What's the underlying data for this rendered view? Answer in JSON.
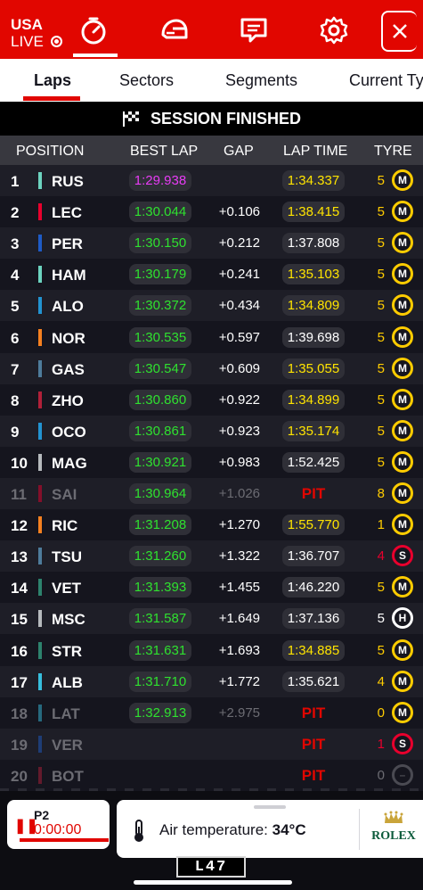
{
  "header": {
    "country": "USA",
    "live_label": "LIVE",
    "icons": [
      "timer-icon",
      "helmet-icon",
      "chat-icon",
      "gear-icon",
      "close-icon"
    ]
  },
  "tabs": [
    {
      "label": "Laps",
      "active": true
    },
    {
      "label": "Sectors",
      "active": false
    },
    {
      "label": "Segments",
      "active": false
    },
    {
      "label": "Current Ty",
      "active": false
    }
  ],
  "session_banner": "SESSION FINISHED",
  "columns": {
    "position": "POSITION",
    "best_lap": "BEST LAP",
    "gap": "GAP",
    "lap_time": "LAP TIME",
    "tyre": "TYRE"
  },
  "rows": [
    {
      "pos": "1",
      "code": "RUS",
      "team_color": "#6cd3bf",
      "best": "1:29.938",
      "best_color": "#e83cf5",
      "gap": "",
      "lap": "1:34.337",
      "lap_style": "yellow",
      "tyre_laps": "5",
      "tyre_laps_color": "#ffcc00",
      "tyre": "M",
      "tyre_type": "medium"
    },
    {
      "pos": "2",
      "code": "LEC",
      "team_color": "#e8002d",
      "best": "1:30.044",
      "best_color": "#2fe12f",
      "gap": "+0.106",
      "lap": "1:38.415",
      "lap_style": "yellow",
      "tyre_laps": "5",
      "tyre_laps_color": "#ffcc00",
      "tyre": "M",
      "tyre_type": "medium"
    },
    {
      "pos": "3",
      "code": "PER",
      "team_color": "#1e5bc6",
      "best": "1:30.150",
      "best_color": "#2fe12f",
      "gap": "+0.212",
      "lap": "1:37.808",
      "lap_style": "white",
      "tyre_laps": "5",
      "tyre_laps_color": "#ffcc00",
      "tyre": "M",
      "tyre_type": "medium"
    },
    {
      "pos": "4",
      "code": "HAM",
      "team_color": "#6cd3bf",
      "best": "1:30.179",
      "best_color": "#2fe12f",
      "gap": "+0.241",
      "lap": "1:35.103",
      "lap_style": "yellow",
      "tyre_laps": "5",
      "tyre_laps_color": "#ffcc00",
      "tyre": "M",
      "tyre_type": "medium"
    },
    {
      "pos": "5",
      "code": "ALO",
      "team_color": "#2293d1",
      "best": "1:30.372",
      "best_color": "#2fe12f",
      "gap": "+0.434",
      "lap": "1:34.809",
      "lap_style": "yellow",
      "tyre_laps": "5",
      "tyre_laps_color": "#ffcc00",
      "tyre": "M",
      "tyre_type": "medium"
    },
    {
      "pos": "6",
      "code": "NOR",
      "team_color": "#f58020",
      "best": "1:30.535",
      "best_color": "#2fe12f",
      "gap": "+0.597",
      "lap": "1:39.698",
      "lap_style": "white",
      "tyre_laps": "5",
      "tyre_laps_color": "#ffcc00",
      "tyre": "M",
      "tyre_type": "medium"
    },
    {
      "pos": "7",
      "code": "GAS",
      "team_color": "#4e7c9b",
      "best": "1:30.547",
      "best_color": "#2fe12f",
      "gap": "+0.609",
      "lap": "1:35.055",
      "lap_style": "yellow",
      "tyre_laps": "5",
      "tyre_laps_color": "#ffcc00",
      "tyre": "M",
      "tyre_type": "medium"
    },
    {
      "pos": "8",
      "code": "ZHO",
      "team_color": "#b12039",
      "best": "1:30.860",
      "best_color": "#2fe12f",
      "gap": "+0.922",
      "lap": "1:34.899",
      "lap_style": "yellow",
      "tyre_laps": "5",
      "tyre_laps_color": "#ffcc00",
      "tyre": "M",
      "tyre_type": "medium"
    },
    {
      "pos": "9",
      "code": "OCO",
      "team_color": "#2293d1",
      "best": "1:30.861",
      "best_color": "#2fe12f",
      "gap": "+0.923",
      "lap": "1:35.174",
      "lap_style": "yellow",
      "tyre_laps": "5",
      "tyre_laps_color": "#ffcc00",
      "tyre": "M",
      "tyre_type": "medium"
    },
    {
      "pos": "10",
      "code": "MAG",
      "team_color": "#b6babd",
      "best": "1:30.921",
      "best_color": "#2fe12f",
      "gap": "+0.983",
      "lap": "1:52.425",
      "lap_style": "white",
      "tyre_laps": "5",
      "tyre_laps_color": "#ffcc00",
      "tyre": "M",
      "tyre_type": "medium"
    },
    {
      "pos": "11",
      "code": "SAI",
      "team_color": "#e8002d",
      "best": "1:30.964",
      "best_color": "#2fe12f",
      "gap": "+1.026",
      "lap": "PIT",
      "lap_style": "pit",
      "tyre_laps": "8",
      "tyre_laps_color": "#ffcc00",
      "tyre": "M",
      "tyre_type": "medium",
      "dim": true
    },
    {
      "pos": "12",
      "code": "RIC",
      "team_color": "#f58020",
      "best": "1:31.208",
      "best_color": "#2fe12f",
      "gap": "+1.270",
      "lap": "1:55.770",
      "lap_style": "yellow",
      "tyre_laps": "1",
      "tyre_laps_color": "#ffcc00",
      "tyre": "M",
      "tyre_type": "medium"
    },
    {
      "pos": "13",
      "code": "TSU",
      "team_color": "#4e7c9b",
      "best": "1:31.260",
      "best_color": "#2fe12f",
      "gap": "+1.322",
      "lap": "1:36.707",
      "lap_style": "white",
      "tyre_laps": "4",
      "tyre_laps_color": "#e8002d",
      "tyre": "S",
      "tyre_type": "soft"
    },
    {
      "pos": "14",
      "code": "VET",
      "team_color": "#2d826d",
      "best": "1:31.393",
      "best_color": "#2fe12f",
      "gap": "+1.455",
      "lap": "1:46.220",
      "lap_style": "white",
      "tyre_laps": "5",
      "tyre_laps_color": "#ffcc00",
      "tyre": "M",
      "tyre_type": "medium"
    },
    {
      "pos": "15",
      "code": "MSC",
      "team_color": "#b6babd",
      "best": "1:31.587",
      "best_color": "#2fe12f",
      "gap": "+1.649",
      "lap": "1:37.136",
      "lap_style": "white",
      "tyre_laps": "5",
      "tyre_laps_color": "#ffffff",
      "tyre": "H",
      "tyre_type": "hard"
    },
    {
      "pos": "16",
      "code": "STR",
      "team_color": "#2d826d",
      "best": "1:31.631",
      "best_color": "#2fe12f",
      "gap": "+1.693",
      "lap": "1:34.885",
      "lap_style": "yellow",
      "tyre_laps": "5",
      "tyre_laps_color": "#ffcc00",
      "tyre": "M",
      "tyre_type": "medium"
    },
    {
      "pos": "17",
      "code": "ALB",
      "team_color": "#37bedd",
      "best": "1:31.710",
      "best_color": "#2fe12f",
      "gap": "+1.772",
      "lap": "1:35.621",
      "lap_style": "white",
      "tyre_laps": "4",
      "tyre_laps_color": "#ffcc00",
      "tyre": "M",
      "tyre_type": "medium"
    },
    {
      "pos": "18",
      "code": "LAT",
      "team_color": "#37bedd",
      "best": "1:32.913",
      "best_color": "#2fe12f",
      "gap": "+2.975",
      "lap": "PIT",
      "lap_style": "pit",
      "tyre_laps": "0",
      "tyre_laps_color": "#ffcc00",
      "tyre": "M",
      "tyre_type": "medium",
      "dim": true
    },
    {
      "pos": "19",
      "code": "VER",
      "team_color": "#1e5bc6",
      "best": "",
      "best_color": "#2fe12f",
      "gap": "",
      "lap": "PIT",
      "lap_style": "pit",
      "tyre_laps": "1",
      "tyre_laps_color": "#e8002d",
      "tyre": "S",
      "tyre_type": "soft",
      "dim": true
    },
    {
      "pos": "20",
      "code": "BOT",
      "team_color": "#b12039",
      "best": "",
      "best_color": "#2fe12f",
      "gap": "",
      "lap": "PIT",
      "lap_style": "pit",
      "tyre_laps": "0",
      "tyre_laps_color": "#6c6c73",
      "tyre": "–",
      "tyre_type": "unknown",
      "dim": true
    }
  ],
  "session_card": {
    "session": "P2",
    "timer": "0:00:00"
  },
  "weather": {
    "label": "Air temperature:",
    "value": "34°C"
  },
  "sponsor": "ROLEX",
  "lap_tag": "L47",
  "colors": {
    "brand_red": "#e10600",
    "background": "#15151e"
  }
}
